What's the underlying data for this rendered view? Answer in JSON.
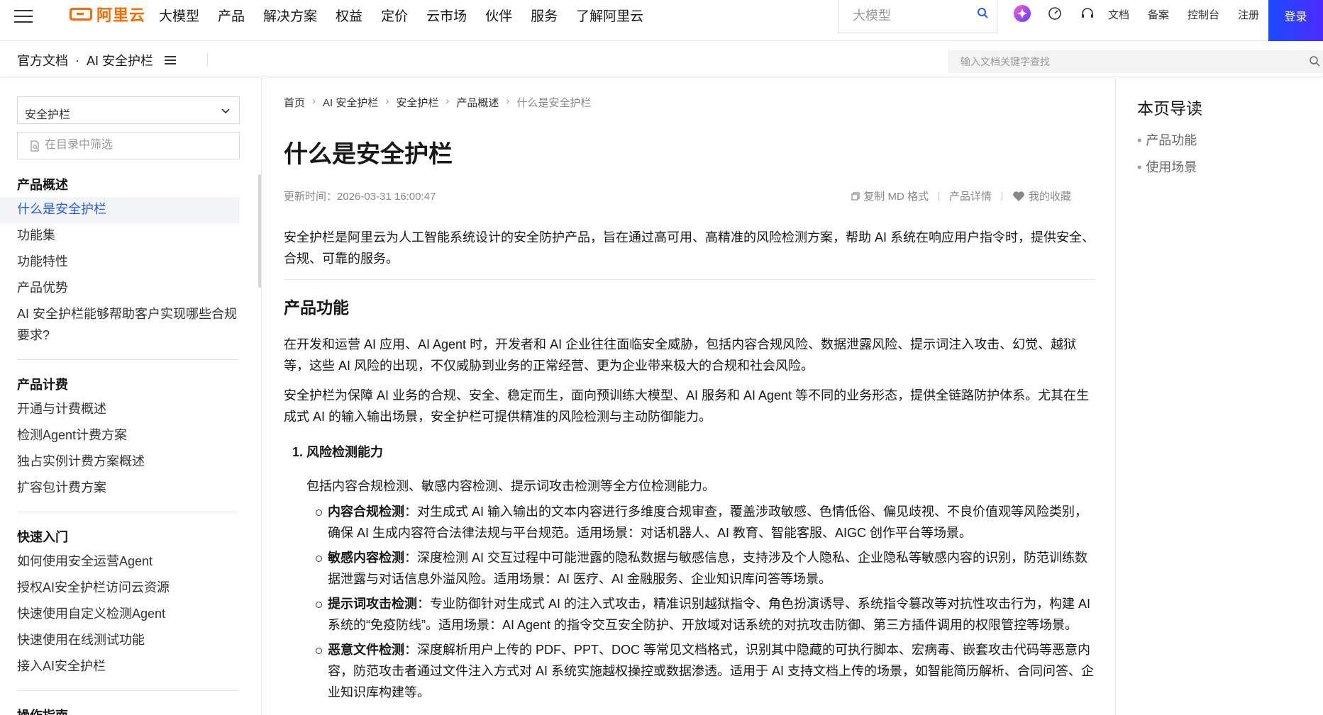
{
  "topnav": {
    "logo_text": "阿里云",
    "items": [
      "大模型",
      "产品",
      "解决方案",
      "权益",
      "定价",
      "云市场",
      "伙伴",
      "服务",
      "了解阿里云"
    ],
    "search_placeholder": "大模型",
    "links": [
      "文档",
      "备案",
      "控制台",
      "注册"
    ],
    "login": "登录"
  },
  "subheader": {
    "crumb_root": "官方文档",
    "crumb_sep": "·",
    "crumb_product": "AI 安全护栏",
    "doc_search_placeholder": "输入文档关键字查找"
  },
  "sidebar": {
    "product_select": "安全护栏",
    "filter_placeholder": "在目录中筛选",
    "groups": [
      {
        "title": "产品概述",
        "items": [
          "什么是安全护栏",
          "功能集",
          "功能特性",
          "产品优势",
          "AI 安全护栏能够帮助客户实现哪些合规要求?"
        ]
      },
      {
        "title": "产品计费",
        "items": [
          "开通与计费概述",
          "检测Agent计费方案",
          "独占实例计费方案概述",
          "扩容包计费方案"
        ]
      },
      {
        "title": "快速入门",
        "items": [
          "如何使用安全运营Agent",
          "授权AI安全护栏访问云资源",
          "快速使用自定义检测Agent",
          "快速使用在线测试功能",
          "接入AI安全护栏"
        ]
      },
      {
        "title": "操作指南",
        "items": []
      }
    ]
  },
  "content": {
    "breadcrumb": [
      "首页",
      "AI 安全护栏",
      "安全护栏",
      "产品概述",
      "什么是安全护栏"
    ],
    "title": "什么是安全护栏",
    "updated": "更新时间：2026-03-31 16:00:47",
    "actions": [
      "复制 MD 格式",
      "产品详情",
      "我的收藏"
    ],
    "intro": "安全护栏是阿里云为人工智能系统设计的安全防护产品，旨在通过高可用、高精准的风险检测方案，帮助 AI 系统在响应用户指令时，提供安全、合规、可靠的服务。",
    "section1_title": "产品功能",
    "section1_p1": "在开发和运营 AI 应用、AI Agent 时，开发者和 AI 企业往往面临安全威胁，包括内容合规风险、数据泄露风险、提示词注入攻击、幻觉、越狱等，这些 AI 风险的出现，不仅威胁到业务的正常经营、更为企业带来极大的合规和社会风险。",
    "section1_p2": "安全护栏为保障 AI 业务的合规、安全、稳定而生，面向预训练大模型、AI 服务和 AI Agent 等不同的业务形态，提供全链路防护体系。尤其在生成式 AI 的输入输出场景，安全护栏可提供精准的风险检测与主动防御能力。",
    "ol1_title": "1. 风险检测能力",
    "ol1_desc": "包括内容合规检测、敏感内容检测、提示词攻击检测等全方位检测能力。",
    "bullets": [
      {
        "term": "内容合规检测",
        "text": "：对生成式 AI 输入输出的文本内容进行多维度合规审查，覆盖涉政敏感、色情低俗、偏见歧视、不良价值观等风险类别，确保 AI 生成内容符合法律法规与平台规范。适用场景：对话机器人、AI 教育、智能客服、AIGC 创作平台等场景。"
      },
      {
        "term": "敏感内容检测",
        "text": "：深度检测 AI 交互过程中可能泄露的隐私数据与敏感信息，支持涉及个人隐私、企业隐私等敏感内容的识别，防范训练数据泄露与对话信息外溢风险。适用场景：AI 医疗、AI 金融服务、企业知识库问答等场景。"
      },
      {
        "term": "提示词攻击检测",
        "text": "：专业防御针对生成式 AI 的注入式攻击，精准识别越狱指令、角色扮演诱导、系统指令篡改等对抗性攻击行为，构建 AI 系统的“免疫防线”。适用场景：AI Agent 的指令交互安全防护、开放域对话系统的对抗攻击防御、第三方插件调用的权限管控等场景。"
      },
      {
        "term": "恶意文件检测",
        "text": "：深度解析用户上传的 PDF、PPT、DOC 等常见文档格式，识别其中隐藏的可执行脚本、宏病毒、嵌套攻击代码等恶意内容，防范攻击者通过文件注入方式对 AI 系统实施越权操控或数据渗透。适用于 AI 支持文档上传的场景，如智能简历解析、合同问答、企业知识库构建等。"
      }
    ]
  },
  "rightnav": {
    "title": "本页导读",
    "items": [
      "产品功能",
      "使用场景"
    ]
  }
}
